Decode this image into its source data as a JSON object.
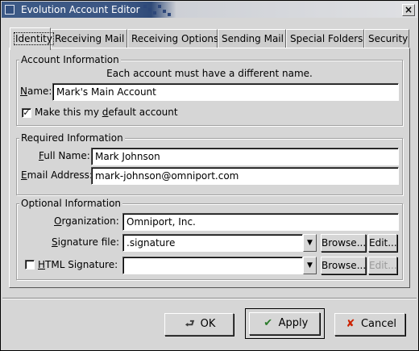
{
  "window": {
    "title": "Evolution Account Editor",
    "close_glyph": "×"
  },
  "tabs": [
    {
      "label": "Identity",
      "active": true
    },
    {
      "label": "Receiving Mail"
    },
    {
      "label": "Receiving Options"
    },
    {
      "label": "Sending Mail"
    },
    {
      "label": "Special Folders"
    },
    {
      "label": "Security"
    }
  ],
  "account_info": {
    "legend": "Account Information",
    "hint": "Each account must have a different name.",
    "name_label": "Name:",
    "name_value": "Mark's Main Account",
    "default_checked": true,
    "default_label": "Make this my default account"
  },
  "required_info": {
    "legend": "Required Information",
    "full_name_label": "Full Name:",
    "full_name_value": "Mark Johnson",
    "email_label": "Email Address:",
    "email_value": "mark-johnson@omniport.com"
  },
  "optional_info": {
    "legend": "Optional Information",
    "organization_label": "Organization:",
    "organization_value": "Omniport, Inc.",
    "signature_label": "Signature file:",
    "signature_value": ".signature",
    "html_signature_checked": false,
    "html_signature_label": "HTML Signature:",
    "html_signature_value": "",
    "browse_label": "Browse...",
    "edit_label": "Edit..."
  },
  "buttons": {
    "ok": "OK",
    "apply": "Apply",
    "cancel": "Cancel"
  },
  "icons": {
    "ok": "ok-icon",
    "apply": "checkmark-icon",
    "cancel": "cancel-x-icon",
    "dropdown": "arrow-down-icon"
  },
  "colors": {
    "titlebar": "#3d5a86",
    "cancel_icon": "#cc2200",
    "apply_icon": "#2a7a2a"
  }
}
